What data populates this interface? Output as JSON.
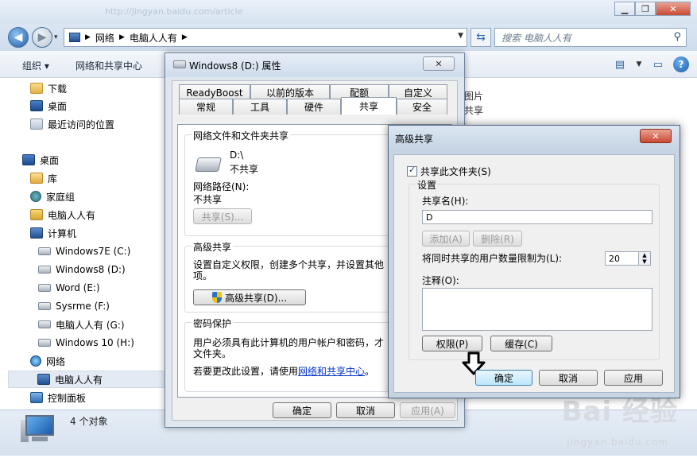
{
  "explorer": {
    "address_ghost": "http://jingyan.baidu.com/article",
    "address": [
      "网络",
      "电脑人人有"
    ],
    "search_placeholder": "搜索 电脑人人有",
    "toolbar": {
      "organize": "组织 ▾",
      "network_center": "网络和共享中心"
    },
    "nav": {
      "favorites": [
        "下载",
        "桌面",
        "最近访问的位置"
      ],
      "desktop": "桌面",
      "library": "库",
      "homegroup": "家庭组",
      "user": "电脑人人有",
      "computer": "计算机",
      "drives": [
        "Windows7E (C:)",
        "Windows8 (D:)",
        "Word (E:)",
        "Sysrme (F:)",
        "电脑人人有 (G:)",
        "Windows 10 (H:)"
      ],
      "network": "网络",
      "network_child": "电脑人人有",
      "control_panel": "控制面板"
    },
    "behind_text": [
      "图片",
      "共享"
    ],
    "status": "4 个对象",
    "watermark": "Bai 经验",
    "watermark_url": "jingyan.baidu.com"
  },
  "props": {
    "title": "Windows8 (D:) 属性",
    "close": "✕",
    "tabs_row1": [
      "ReadyBoost",
      "以前的版本",
      "配额",
      "自定义"
    ],
    "tabs_row2": [
      "常规",
      "工具",
      "硬件",
      "共享",
      "安全"
    ],
    "active_tab": "共享",
    "net_share": {
      "label": "网络文件和文件夹共享",
      "path": "D:\\",
      "state": "不共享",
      "netpath_label": "网络路径(N):",
      "netpath_value": "不共享",
      "share_button": "共享(S)..."
    },
    "adv_share": {
      "label": "高级共享",
      "desc1": "设置自定义权限，创建多个共享，并设置其他",
      "desc2": "项。",
      "button": "高级共享(D)..."
    },
    "password": {
      "label": "密码保护",
      "desc1": "用户必须具有此计算机的用户帐户和密码，才",
      "desc2": "文件夹。",
      "change_prefix": "若要更改此设置，请使用",
      "change_link": "网络和共享中心",
      "change_suffix": "。"
    },
    "buttons": {
      "ok": "确定",
      "cancel": "取消",
      "apply": "应用(A)"
    }
  },
  "adv": {
    "title": "高级共享",
    "close": "✕",
    "share_checkbox": "共享此文件夹(S)",
    "settings_label": "设置",
    "share_name_label": "共享名(H):",
    "share_name_value": "D",
    "add_button": "添加(A)",
    "remove_button": "删除(R)",
    "limit_label": "将同时共享的用户数量限制为(L):",
    "limit_value": "20",
    "comment_label": "注释(O):",
    "permissions_button": "权限(P)",
    "cache_button": "缓存(C)",
    "buttons": {
      "ok": "确定",
      "cancel": "取消",
      "apply": "应用"
    }
  }
}
